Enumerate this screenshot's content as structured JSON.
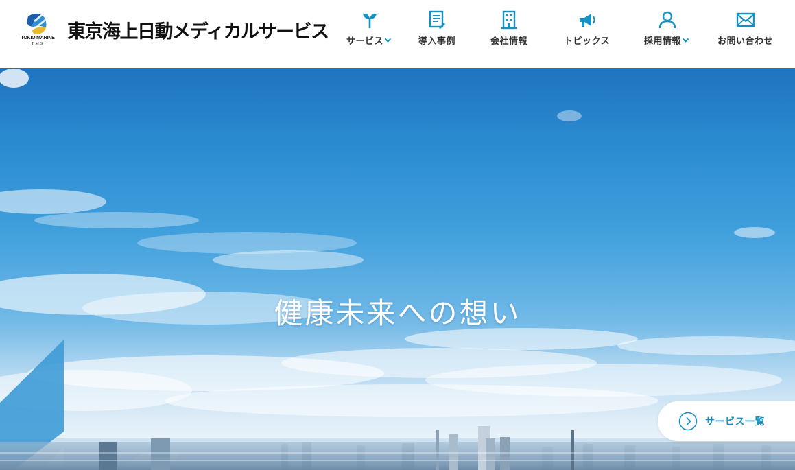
{
  "brand": {
    "logo_line1": "TOKIO MARINE",
    "logo_line2": "TMS",
    "company_name": "東京海上日動メディカルサービス"
  },
  "nav": {
    "items": [
      {
        "label": "サービス",
        "icon": "sprout-icon",
        "dropdown": true
      },
      {
        "label": "導入事例",
        "icon": "document-icon",
        "dropdown": false
      },
      {
        "label": "会社情報",
        "icon": "building-icon",
        "dropdown": false
      },
      {
        "label": "トピックス",
        "icon": "megaphone-icon",
        "dropdown": false
      },
      {
        "label": "採用情報",
        "icon": "person-icon",
        "dropdown": true
      },
      {
        "label": "お問い合わせ",
        "icon": "mail-icon",
        "dropdown": false
      }
    ]
  },
  "hero": {
    "title": "健康未来への想い",
    "cta_label": "サービス一覧"
  },
  "colors": {
    "accent": "#1592c4",
    "text": "#333333",
    "sky_top": "#1f74bf",
    "sky_bottom": "#d6e6f1"
  }
}
